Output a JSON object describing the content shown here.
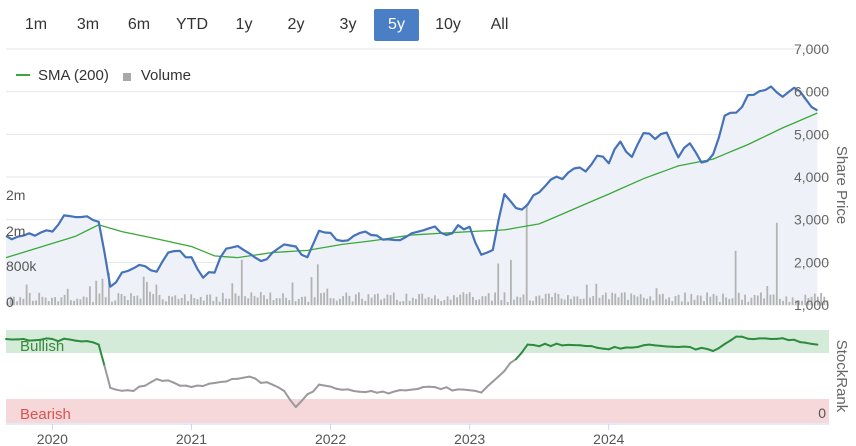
{
  "range_buttons": [
    {
      "label": "1m",
      "active": false
    },
    {
      "label": "3m",
      "active": false
    },
    {
      "label": "6m",
      "active": false
    },
    {
      "label": "YTD",
      "active": false
    },
    {
      "label": "1y",
      "active": false
    },
    {
      "label": "2y",
      "active": false
    },
    {
      "label": "3y",
      "active": false
    },
    {
      "label": "5y",
      "active": true
    },
    {
      "label": "10y",
      "active": false
    },
    {
      "label": "All",
      "active": false
    }
  ],
  "legend": {
    "sma_label": "SMA (200)",
    "volume_label": "Volume"
  },
  "colors": {
    "price": "#4572b8",
    "sma": "#3aa83a",
    "volume": "#b3b3b3",
    "stockrank_bullish": "#2e8b3e",
    "stockrank_neutral": "#9a9a9a",
    "bullish_band": "#d3ebd8",
    "bearish_band": "#f6d7da",
    "bullish_text": "#3a8a3a",
    "bearish_text": "#d9534f",
    "active_button": "#4a7fc6"
  },
  "chart_data": {
    "type": "line",
    "x_axis": {
      "ticks": [
        "2020",
        "2021",
        "2022",
        "2023",
        "2024"
      ],
      "range": [
        "2019-09",
        "2024-09"
      ]
    },
    "price_axis": {
      "title": "Share Price",
      "ticks": [
        "1,000",
        "2,000",
        "3,000",
        "4,000",
        "5,000",
        "6,000",
        "7,000"
      ],
      "range": [
        1000,
        7000
      ]
    },
    "volume_axis": {
      "ticks": [
        "0",
        "800k",
        "2m",
        "2m"
      ]
    },
    "stockrank_axis": {
      "title": "StockRank",
      "ticks": [
        "0"
      ],
      "band_labels": {
        "bullish": "Bullish",
        "bearish": "Bearish"
      }
    },
    "series": [
      {
        "name": "Price",
        "points": [
          [
            "2019-09",
            2620
          ],
          [
            "2019-10",
            2600
          ],
          [
            "2019-11",
            2680
          ],
          [
            "2019-12",
            2700
          ],
          [
            "2020-01",
            2720
          ],
          [
            "2020-02",
            3100
          ],
          [
            "2020-03",
            3060
          ],
          [
            "2020-04",
            3080
          ],
          [
            "2020-05",
            2950
          ],
          [
            "2020-06",
            1430
          ],
          [
            "2020-07",
            1760
          ],
          [
            "2020-08",
            1860
          ],
          [
            "2020-09",
            1910
          ],
          [
            "2020-10",
            1780
          ],
          [
            "2020-11",
            2230
          ],
          [
            "2020-12",
            2270
          ],
          [
            "2021-01",
            2120
          ],
          [
            "2021-02",
            1640
          ],
          [
            "2021-03",
            1760
          ],
          [
            "2021-04",
            2320
          ],
          [
            "2021-05",
            2380
          ],
          [
            "2021-06",
            2210
          ],
          [
            "2021-07",
            2030
          ],
          [
            "2021-08",
            2230
          ],
          [
            "2021-09",
            2420
          ],
          [
            "2021-10",
            2370
          ],
          [
            "2021-11",
            2120
          ],
          [
            "2021-12",
            2740
          ],
          [
            "2022-01",
            2690
          ],
          [
            "2022-02",
            2500
          ],
          [
            "2022-03",
            2620
          ],
          [
            "2022-04",
            2720
          ],
          [
            "2022-05",
            2630
          ],
          [
            "2022-06",
            2540
          ],
          [
            "2022-07",
            2520
          ],
          [
            "2022-08",
            2680
          ],
          [
            "2022-09",
            2750
          ],
          [
            "2022-10",
            2840
          ],
          [
            "2022-11",
            2640
          ],
          [
            "2022-12",
            2870
          ],
          [
            "2023-01",
            2830
          ],
          [
            "2023-02",
            2180
          ],
          [
            "2023-03",
            2290
          ],
          [
            "2023-04",
            3600
          ],
          [
            "2023-05",
            3270
          ],
          [
            "2023-06",
            3350
          ],
          [
            "2023-07",
            3640
          ],
          [
            "2023-08",
            3940
          ],
          [
            "2023-09",
            3950
          ],
          [
            "2023-10",
            4200
          ],
          [
            "2023-11",
            4130
          ],
          [
            "2023-12",
            4500
          ],
          [
            "2024-01",
            4320
          ],
          [
            "2024-02",
            4830
          ],
          [
            "2024-03",
            4470
          ],
          [
            "2024-04",
            5030
          ],
          [
            "2024-05",
            4890
          ],
          [
            "2024-06",
            5040
          ],
          [
            "2024-07",
            4460
          ],
          [
            "2024-08",
            4790
          ],
          [
            "2024-09",
            4340
          ],
          [
            "2024-10",
            4530
          ],
          [
            "2024-11",
            5440
          ],
          [
            "2024-12",
            5510
          ],
          [
            "2025-01",
            5920
          ],
          [
            "2025-02",
            6010
          ],
          [
            "2025-03",
            6120
          ],
          [
            "2025-04",
            5880
          ],
          [
            "2025-05",
            6090
          ],
          [
            "2025-06",
            5820
          ],
          [
            "2025-07",
            5560
          ]
        ]
      },
      {
        "name": "SMA (200)",
        "points": [
          [
            "2019-09",
            2110
          ],
          [
            "2019-12",
            2360
          ],
          [
            "2020-03",
            2610
          ],
          [
            "2020-05",
            2880
          ],
          [
            "2020-07",
            2720
          ],
          [
            "2020-10",
            2550
          ],
          [
            "2021-01",
            2370
          ],
          [
            "2021-03",
            2150
          ],
          [
            "2021-05",
            2110
          ],
          [
            "2021-08",
            2230
          ],
          [
            "2021-11",
            2280
          ],
          [
            "2022-02",
            2420
          ],
          [
            "2022-05",
            2520
          ],
          [
            "2022-08",
            2640
          ],
          [
            "2022-11",
            2690
          ],
          [
            "2023-01",
            2720
          ],
          [
            "2023-04",
            2760
          ],
          [
            "2023-07",
            2900
          ],
          [
            "2023-10",
            3250
          ],
          [
            "2024-01",
            3600
          ],
          [
            "2024-04",
            3960
          ],
          [
            "2024-07",
            4260
          ],
          [
            "2024-10",
            4420
          ],
          [
            "2025-01",
            4760
          ],
          [
            "2025-04",
            5150
          ],
          [
            "2025-07",
            5500
          ]
        ]
      },
      {
        "name": "StockRank",
        "points": [
          [
            "2019-09",
            95
          ],
          [
            "2020-03",
            93
          ],
          [
            "2020-05",
            88
          ],
          [
            "2020-06",
            34
          ],
          [
            "2020-08",
            30
          ],
          [
            "2020-10",
            45
          ],
          [
            "2021-01",
            35
          ],
          [
            "2021-03",
            40
          ],
          [
            "2021-06",
            48
          ],
          [
            "2021-09",
            30
          ],
          [
            "2021-10",
            10
          ],
          [
            "2021-12",
            38
          ],
          [
            "2022-03",
            30
          ],
          [
            "2022-06",
            27
          ],
          [
            "2022-09",
            35
          ],
          [
            "2022-12",
            32
          ],
          [
            "2023-02",
            28
          ],
          [
            "2023-04",
            55
          ],
          [
            "2023-06",
            88
          ],
          [
            "2023-09",
            87
          ],
          [
            "2023-12",
            84
          ],
          [
            "2024-02",
            83
          ],
          [
            "2024-05",
            87
          ],
          [
            "2024-08",
            85
          ],
          [
            "2024-10",
            80
          ],
          [
            "2024-12",
            98
          ],
          [
            "2025-03",
            95
          ],
          [
            "2025-05",
            94
          ],
          [
            "2025-07",
            88
          ]
        ]
      }
    ]
  }
}
